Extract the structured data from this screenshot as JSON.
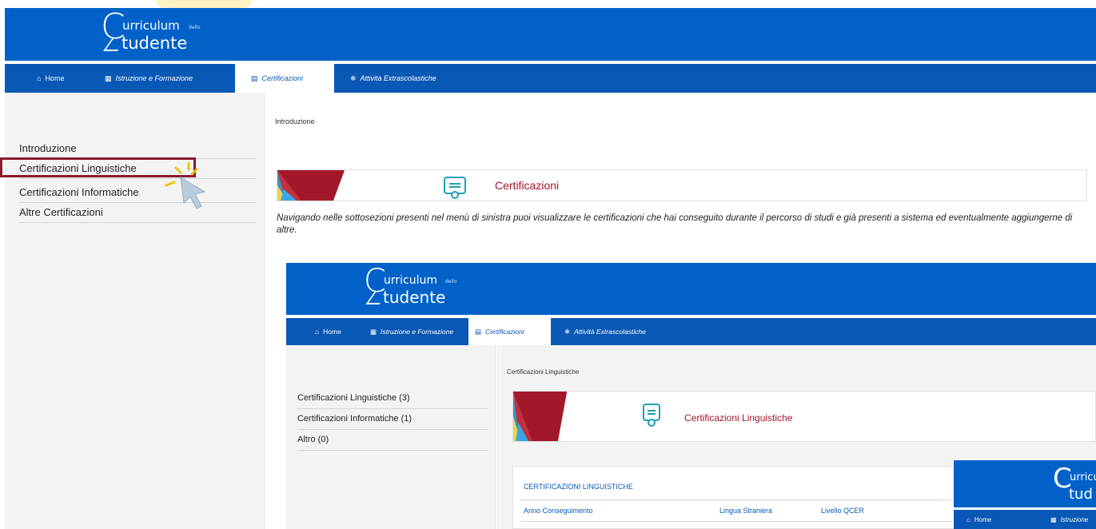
{
  "logo": {
    "first_letter": "C",
    "word1": "urriculum",
    "dello": "dello",
    "word2": "tudente"
  },
  "nav": {
    "home": "Home",
    "istruzione": "Istruzione e Formazione",
    "certificazioni": "Certificazioni",
    "attivita": "Attività Extrascolastiche"
  },
  "sidebar": {
    "items": [
      "Introduzione",
      "Certificazioni Linguistiche",
      "Certificazioni Informatiche",
      "Altre Certificazioni"
    ]
  },
  "main": {
    "breadcrumb": "Introduzione",
    "banner_title": "Certificazioni",
    "description": "Navigando nelle sottosezioni presenti nel menù di sinistra puoi visualizzare le certificazioni che hai conseguito durante il percorso di studi e già presenti a sistema ed eventualmente aggiungerne di altre."
  },
  "inner": {
    "nav": {
      "home": "Home",
      "istruzione": "Istruzione e Formazione",
      "certificazioni": "Certificazioni",
      "attivita": "Attività Extrascolastiche"
    },
    "sidebar": [
      "Certificazioni Linguistiche (3)",
      "Certificazioni Informatiche (1)",
      "Altro (0)"
    ],
    "breadcrumb": "Certificazioni Linguistiche",
    "banner_title": "Certificazioni Linguistiche",
    "table_title": "CERTIFICAZIONI LINGUISTICHE",
    "columns": [
      "Anno Conseguimento",
      "Lingua Straniera",
      "Livello QCER"
    ]
  },
  "inner2": {
    "logo_first": "C",
    "logo_w1": "urricu",
    "logo_w2": "tud",
    "nav_home": "Home",
    "nav_istruzione": "Istruzione"
  },
  "colors": {
    "header_blue": "#0061c9",
    "nav_blue": "#0a58b5",
    "accent_red": "#a3172b",
    "highlight": "#8b1a2e",
    "icon_teal": "#1fa0b4"
  }
}
